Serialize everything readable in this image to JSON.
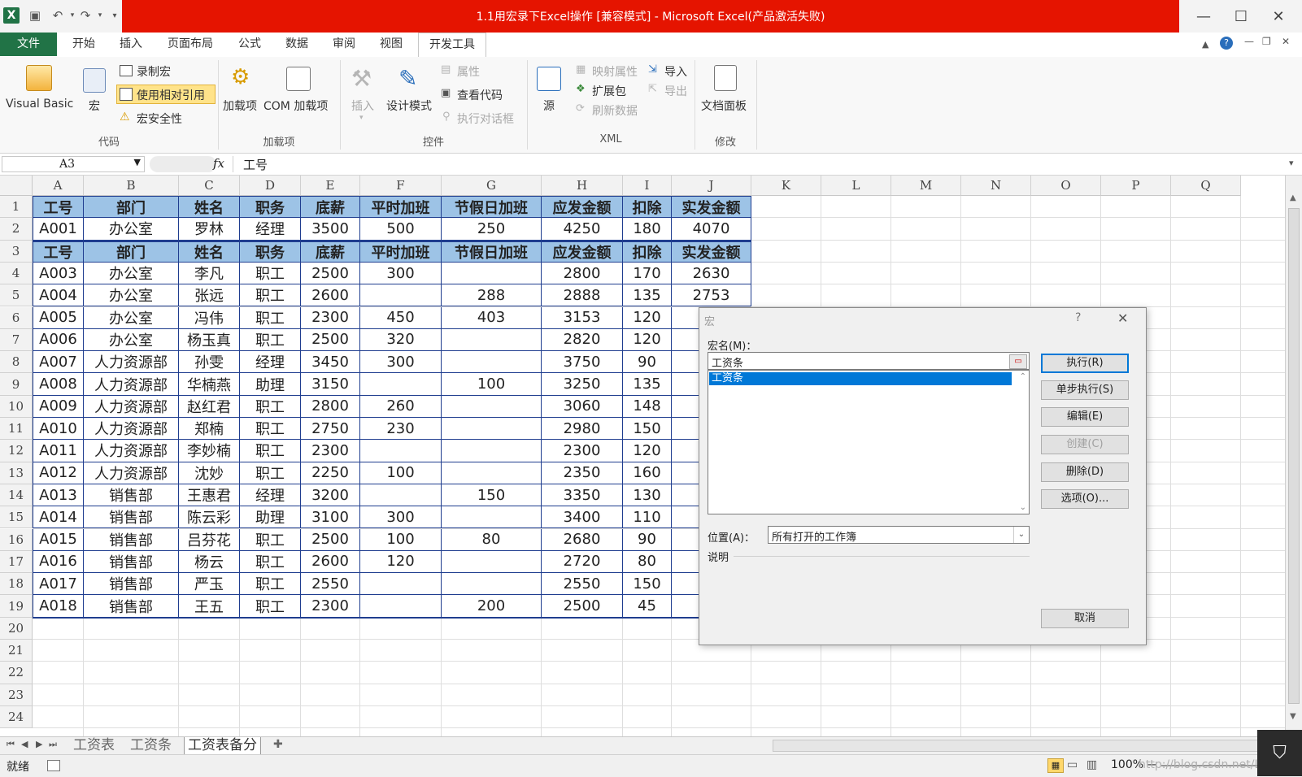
{
  "window": {
    "title": "1.1用宏录下Excel操作  [兼容模式] - Microsoft Excel(产品激活失败)"
  },
  "tabs": [
    "文件",
    "开始",
    "插入",
    "页面布局",
    "公式",
    "数据",
    "审阅",
    "视图",
    "开发工具"
  ],
  "ribbon": {
    "code": {
      "group": "代码",
      "visual_basic": "Visual Basic",
      "macros": "宏",
      "record": "录制宏",
      "relative": "使用相对引用",
      "security": "宏安全性"
    },
    "addins": {
      "group": "加载项",
      "addins": "加载项",
      "com_addins": "COM 加载项"
    },
    "controls": {
      "group": "控件",
      "insert": "插入",
      "design_mode": "设计模式",
      "properties": "属性",
      "view_code": "查看代码",
      "run_dialog": "执行对话框"
    },
    "xml": {
      "group": "XML",
      "source": "源",
      "map_props": "映射属性",
      "expansion": "扩展包",
      "refresh": "刷新数据",
      "import": "导入",
      "export": "导出"
    },
    "modify": {
      "group": "修改",
      "doc_panel": "文档面板"
    }
  },
  "formula_bar": {
    "name_box": "A3",
    "fx": "fx",
    "content": "工号"
  },
  "grid": {
    "columns": [
      "A",
      "B",
      "C",
      "D",
      "E",
      "F",
      "G",
      "H",
      "I",
      "J",
      "K",
      "L",
      "M",
      "N",
      "O",
      "P",
      "Q"
    ],
    "row_numbers": [
      "1",
      "2",
      "3",
      "4",
      "5",
      "6",
      "7",
      "8",
      "9",
      "10",
      "11",
      "12",
      "13",
      "14",
      "15",
      "16",
      "17",
      "18",
      "19",
      "20",
      "21",
      "22",
      "23",
      "24"
    ],
    "headers": [
      "工号",
      "部门",
      "姓名",
      "职务",
      "底薪",
      "平时加班",
      "节假日加班",
      "应发金额",
      "扣除",
      "实发金额"
    ],
    "rows": [
      [
        "A001",
        "办公室",
        "罗林",
        "经理",
        "3500",
        "500",
        "250",
        "4250",
        "180",
        "4070"
      ],
      [
        "A003",
        "办公室",
        "李凡",
        "职工",
        "2500",
        "300",
        "",
        "2800",
        "170",
        "2630"
      ],
      [
        "A004",
        "办公室",
        "张远",
        "职工",
        "2600",
        "",
        "288",
        "2888",
        "135",
        "2753"
      ],
      [
        "A005",
        "办公室",
        "冯伟",
        "职工",
        "2300",
        "450",
        "403",
        "3153",
        "120",
        ""
      ],
      [
        "A006",
        "办公室",
        "杨玉真",
        "职工",
        "2500",
        "320",
        "",
        "2820",
        "120",
        ""
      ],
      [
        "A007",
        "人力资源部",
        "孙雯",
        "经理",
        "3450",
        "300",
        "",
        "3750",
        "90",
        ""
      ],
      [
        "A008",
        "人力资源部",
        "华楠燕",
        "助理",
        "3150",
        "",
        "100",
        "3250",
        "135",
        ""
      ],
      [
        "A009",
        "人力资源部",
        "赵红君",
        "职工",
        "2800",
        "260",
        "",
        "3060",
        "148",
        ""
      ],
      [
        "A010",
        "人力资源部",
        "郑楠",
        "职工",
        "2750",
        "230",
        "",
        "2980",
        "150",
        ""
      ],
      [
        "A011",
        "人力资源部",
        "李妙楠",
        "职工",
        "2300",
        "",
        "",
        "2300",
        "120",
        ""
      ],
      [
        "A012",
        "人力资源部",
        "沈妙",
        "职工",
        "2250",
        "100",
        "",
        "2350",
        "160",
        ""
      ],
      [
        "A013",
        "销售部",
        "王惠君",
        "经理",
        "3200",
        "",
        "150",
        "3350",
        "130",
        ""
      ],
      [
        "A014",
        "销售部",
        "陈云彩",
        "助理",
        "3100",
        "300",
        "",
        "3400",
        "110",
        ""
      ],
      [
        "A015",
        "销售部",
        "吕芬花",
        "职工",
        "2500",
        "100",
        "80",
        "2680",
        "90",
        ""
      ],
      [
        "A016",
        "销售部",
        "杨云",
        "职工",
        "2600",
        "120",
        "",
        "2720",
        "80",
        ""
      ],
      [
        "A017",
        "销售部",
        "严玉",
        "职工",
        "2550",
        "",
        "",
        "2550",
        "150",
        ""
      ],
      [
        "A018",
        "销售部",
        "王五",
        "职工",
        "2300",
        "",
        "200",
        "2500",
        "45",
        ""
      ]
    ]
  },
  "sheets": [
    "工资表",
    "工资条",
    "工资表备分"
  ],
  "status": {
    "ready": "就绪",
    "zoom": "100%",
    "watermark": "http://blog.csdn.net/Lrash"
  },
  "dialog": {
    "title": "宏",
    "help": "?",
    "close": "✕",
    "name_label": "宏名(M)：",
    "name_value": "工资条",
    "list": [
      "工资条"
    ],
    "location_label": "位置(A)：",
    "location_value": "所有打开的工作簿",
    "desc_label": "说明",
    "buttons": {
      "run": "执行(R)",
      "step": "单步执行(S)",
      "edit": "编辑(E)",
      "create": "创建(C)",
      "delete": "删除(D)",
      "options": "选项(O)...",
      "cancel": "取消"
    }
  },
  "colors": {
    "title_red": "#e51400",
    "file_green": "#217346",
    "header_blue": "#9dc3e6",
    "table_border": "#1f3d8f",
    "select_blue": "#0078d7"
  }
}
